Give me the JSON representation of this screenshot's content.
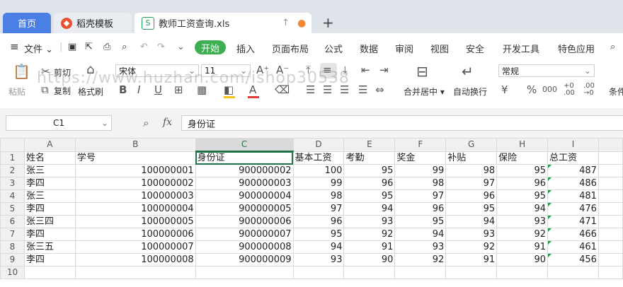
{
  "tabs": {
    "home": "首页",
    "template": "稻壳模板",
    "doc": "教师工资查询.xls"
  },
  "menu": {
    "file": "文件",
    "start": "开始",
    "items": [
      "插入",
      "页面布局",
      "公式",
      "数据",
      "审阅",
      "视图",
      "安全",
      "开发工具",
      "特色应用"
    ]
  },
  "ribbon": {
    "paste": "粘贴",
    "cut": "剪切",
    "copy": "复制",
    "format_painter": "格式刷",
    "font_name": "宋体",
    "font_size": "11",
    "merge_center": "合并居中",
    "wrap_text": "自动换行",
    "number_format": "常规",
    "conditional": "条件",
    "watermark": "https://www.huzhan.com/ishop30538"
  },
  "formula": {
    "name_box": "C1",
    "fx": "fx",
    "content": "身份证"
  },
  "sheet": {
    "col_headers": [
      "A",
      "B",
      "C",
      "D",
      "E",
      "F",
      "G",
      "H",
      "I"
    ],
    "rows": [
      {
        "n": "1",
        "cells": [
          "姓名",
          "学号",
          "身份证",
          "基本工资",
          "考勤",
          "奖金",
          "补贴",
          "保险",
          "总工资"
        ]
      },
      {
        "n": "2",
        "cells": [
          "张三",
          "100000001",
          "900000002",
          "100",
          "95",
          "99",
          "98",
          "95",
          "487"
        ]
      },
      {
        "n": "3",
        "cells": [
          "李四",
          "100000002",
          "900000003",
          "99",
          "96",
          "98",
          "97",
          "96",
          "486"
        ]
      },
      {
        "n": "4",
        "cells": [
          "张三",
          "100000003",
          "900000004",
          "98",
          "95",
          "97",
          "96",
          "95",
          "481"
        ]
      },
      {
        "n": "5",
        "cells": [
          "李四",
          "100000004",
          "900000005",
          "97",
          "94",
          "96",
          "95",
          "94",
          "476"
        ]
      },
      {
        "n": "6",
        "cells": [
          "张三四",
          "100000005",
          "900000006",
          "96",
          "93",
          "95",
          "94",
          "93",
          "471"
        ]
      },
      {
        "n": "7",
        "cells": [
          "李四",
          "100000006",
          "900000007",
          "95",
          "92",
          "94",
          "93",
          "92",
          "466"
        ]
      },
      {
        "n": "8",
        "cells": [
          "张三五",
          "100000007",
          "900000008",
          "94",
          "91",
          "93",
          "92",
          "91",
          "461"
        ]
      },
      {
        "n": "9",
        "cells": [
          "李四",
          "100000008",
          "900000009",
          "93",
          "90",
          "92",
          "91",
          "90",
          "456"
        ]
      },
      {
        "n": "10",
        "cells": [
          "",
          "",
          "",
          "",
          "",
          "",
          "",
          "",
          ""
        ]
      }
    ]
  },
  "colors": {
    "accent": "#3eae52",
    "tab_home": "#4a7fe6",
    "selection": "#217346"
  }
}
